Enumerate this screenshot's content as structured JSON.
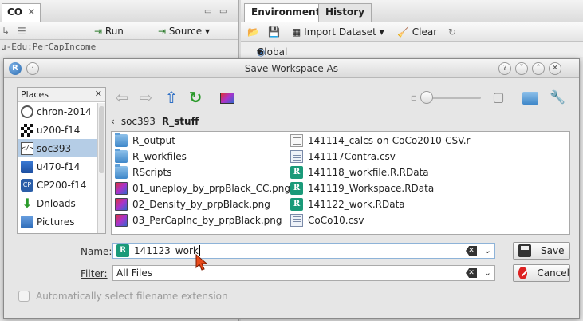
{
  "background": {
    "left_pane": {
      "tab_label": "CO",
      "run_label": "Run",
      "source_label": "Source",
      "code_line": "u-Edu:PerCapIncome"
    },
    "right_pane": {
      "tabs": [
        "Environment",
        "History"
      ],
      "import_label": "Import Dataset",
      "clear_label": "Clear",
      "env_label": "Global Environment"
    }
  },
  "dialog": {
    "title": "Save Workspace As",
    "places": {
      "header": "Places",
      "items": [
        {
          "label": "chron-2014",
          "icon": "clock-icon"
        },
        {
          "label": "u200-f14",
          "icon": "grid-icon"
        },
        {
          "label": "soc393",
          "icon": "code-folder-icon",
          "selected": true
        },
        {
          "label": "u470-f14",
          "icon": "blue-app-icon"
        },
        {
          "label": "CP200-f14",
          "icon": "cp-app-icon"
        },
        {
          "label": "Dnloads",
          "icon": "download-icon"
        },
        {
          "label": "Pictures",
          "icon": "pictures-icon"
        }
      ]
    },
    "breadcrumb": {
      "parent": "soc393",
      "current": "R_stuff"
    },
    "files_left": [
      {
        "name": "R_output",
        "type": "folder"
      },
      {
        "name": "R_workfiles",
        "type": "folder"
      },
      {
        "name": "RScripts",
        "type": "folder"
      },
      {
        "name": "01_uneploy_by_prpBlack_CC.png",
        "type": "png"
      },
      {
        "name": "02_Density_by_prpBlack.png",
        "type": "png"
      },
      {
        "name": "03_PerCapInc_by_prpBlack.png",
        "type": "png"
      }
    ],
    "files_right": [
      {
        "name": "141114_calcs-on-CoCo2010-CSV.r",
        "type": "text"
      },
      {
        "name": "141117Contra.csv",
        "type": "csv"
      },
      {
        "name": "141118_workfile.R.RData",
        "type": "rdata"
      },
      {
        "name": "141119_Workspace.RData",
        "type": "rdata"
      },
      {
        "name": "141122_work.RData",
        "type": "rdata"
      },
      {
        "name": "CoCo10.csv",
        "type": "csv"
      }
    ],
    "name_label": "Name:",
    "name_value": "141123_work",
    "filter_label": "Filter:",
    "filter_value": "All Files",
    "save_label": "Save",
    "cancel_label": "Cancel",
    "auto_ext_label": "Automatically select filename extension",
    "colors": {
      "selection": "#b5cde6",
      "rdata_icon": "#1a9a79",
      "accent_arrow": "#e84a1a"
    }
  }
}
